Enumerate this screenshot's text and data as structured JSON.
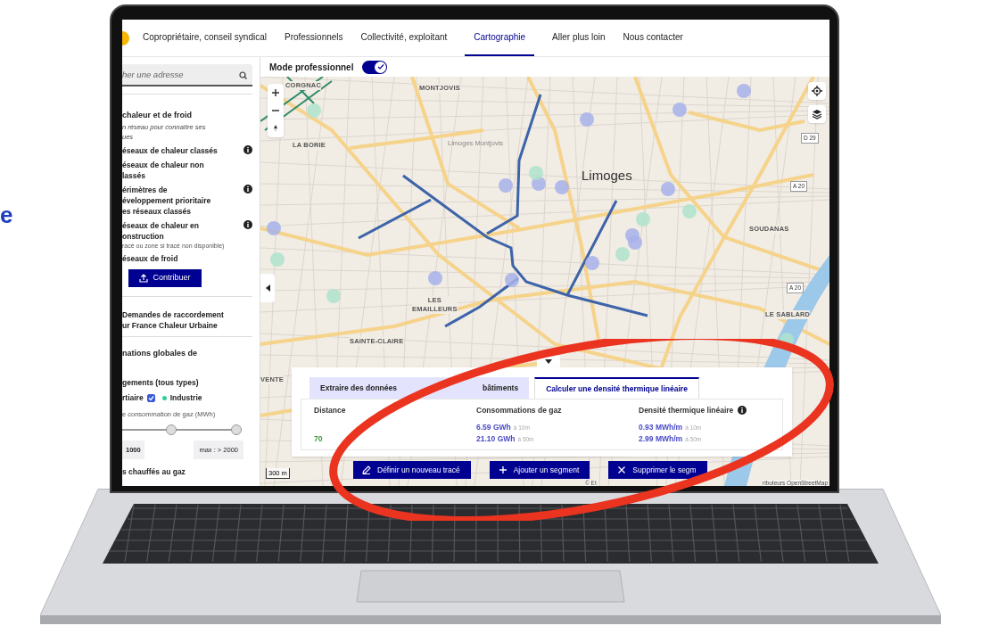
{
  "edge_text": "e",
  "nav": {
    "items": [
      {
        "label": "Copropriétaire, conseil syndical",
        "selected": false
      },
      {
        "label": "Professionnels",
        "selected": false
      },
      {
        "label": "Collectivité, exploitant",
        "selected": false
      },
      {
        "label": "Cartographie",
        "selected": true
      },
      {
        "label": "Aller plus loin",
        "selected": false
      },
      {
        "label": "Nous contacter",
        "selected": false
      }
    ]
  },
  "sidebar": {
    "search": {
      "placeholder": "her une adresse"
    },
    "networks": {
      "title": "chaleur et de froid",
      "subtitle_lines": [
        "n réseau pour connaître ses",
        "ues"
      ],
      "layers": [
        {
          "lines": [
            "éseaux de chaleur classés"
          ],
          "info": true
        },
        {
          "lines": [
            "éseaux de chaleur non",
            "lassés"
          ],
          "info": false
        },
        {
          "lines": [
            "érimètres de",
            "éveloppement prioritaire",
            "es réseaux classés"
          ],
          "info": true
        },
        {
          "lines": [
            "éseaux de chaleur en",
            "onstruction"
          ],
          "note": "racé ou zone si tracé non disponible)",
          "info": true
        },
        {
          "lines": [
            "éseaux de froid"
          ],
          "info": false
        }
      ],
      "button": "Contribuer"
    },
    "requests": [
      "Demandes de raccordement",
      "ur France Chaleur Urbaine"
    ],
    "consumption": {
      "title": "nations globales de",
      "subtitle": "gements (tous types)",
      "filters": [
        {
          "label": "rtiaire",
          "kind": "checkbox",
          "checked": true
        },
        {
          "label": "Industrie",
          "kind": "dot",
          "color": "#34cb9e"
        }
      ],
      "slider_label": "e consommation de gaz (MWh)",
      "thumbs": [
        {
          "level": 0.4
        },
        {
          "level": 1
        }
      ],
      "min": "1000",
      "max": "max : > 2000"
    },
    "last": "s chauffés au gaz"
  },
  "mode": {
    "label": "Mode professionnel",
    "on": true
  },
  "map": {
    "labels": [
      {
        "text": "CORGNAC",
        "kind": "district"
      },
      {
        "text": "MONTJOVIS",
        "kind": "district"
      },
      {
        "text": "LA BORIE",
        "kind": "district"
      },
      {
        "text": "Limoges Montjovis",
        "kind": "station"
      },
      {
        "text": "Limoges",
        "kind": "city"
      },
      {
        "text": "SOUDANAS",
        "kind": "district"
      },
      {
        "text": "LES\nEMAILLEURS",
        "kind": "district"
      },
      {
        "text": "SAINTE-CLAIRE",
        "kind": "district"
      },
      {
        "text": "LE SABLARD",
        "kind": "district"
      },
      {
        "text": "VENTE",
        "kind": "district"
      },
      {
        "text": "D 29",
        "kind": "road"
      },
      {
        "text": "A 20",
        "kind": "road"
      },
      {
        "text": "A 20",
        "kind": "road"
      }
    ],
    "scale": "300 m",
    "attribution": [
      "© Et",
      "ributeurs OpenStreetMap"
    ]
  },
  "panel": {
    "tabs": [
      {
        "parts": [
          "Extraire des données",
          "bâtiments"
        ],
        "selected": false
      },
      {
        "parts": [
          "Calculer une densité thermique linéaire"
        ],
        "selected": true
      }
    ],
    "columns": [
      {
        "title": "Distance",
        "info": false,
        "values": [
          {
            "value": "70"
          }
        ],
        "kind": "distance"
      },
      {
        "title": "Consommations de gaz",
        "info": false,
        "values": [
          {
            "value": "6.59 GWh",
            "note": "à 10m"
          },
          {
            "value": "21.10 GWh",
            "note": "à 50m"
          }
        ],
        "kind": "measure"
      },
      {
        "title": "Densité thermique linéaire",
        "info": true,
        "values": [
          {
            "value": "0.93 MWh/m",
            "note": "à 10m"
          },
          {
            "value": "2.99 MWh/m",
            "note": "à 50m"
          }
        ],
        "kind": "measure"
      }
    ],
    "buttons": [
      {
        "label": "Définir un nouveau tracé",
        "kind": "pencil"
      },
      {
        "label": "Ajouter un segment",
        "kind": "plus"
      },
      {
        "label": "Supprimer le segm",
        "kind": "cross"
      }
    ]
  }
}
